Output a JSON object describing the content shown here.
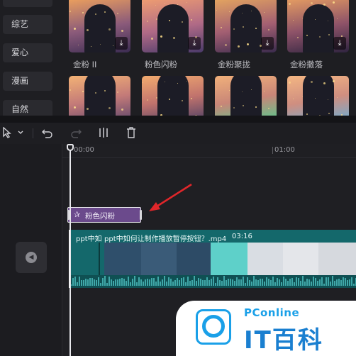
{
  "categories": [
    {
      "label": ""
    },
    {
      "label": "综艺"
    },
    {
      "label": "爱心"
    },
    {
      "label": "漫画"
    },
    {
      "label": "自然"
    }
  ],
  "effects_row1": [
    {
      "label": "金粉 II",
      "palette": [
        "#f0a35c",
        "#8a5a7a",
        "#3b2c52"
      ]
    },
    {
      "label": "粉色闪粉",
      "palette": [
        "#f2a070",
        "#b06a86",
        "#4a3a6a"
      ]
    },
    {
      "label": "金粉聚拢",
      "palette": [
        "#e7a85f",
        "#a35f72",
        "#3a2b4d"
      ]
    },
    {
      "label": "金粉撒落",
      "palette": [
        "#e9a062",
        "#8d5268",
        "#2f2440"
      ]
    }
  ],
  "effects_row2": [
    {
      "palette": [
        "#f3b275",
        "#c37a78",
        "#6b4d6e"
      ]
    },
    {
      "palette": [
        "#f2ab6f",
        "#c1736d",
        "#5d4766"
      ]
    },
    {
      "palette": [
        "#f1b07a",
        "#c88678",
        "#65c28c"
      ]
    },
    {
      "palette": [
        "#f4b683",
        "#cf8e80",
        "#7aa9c9"
      ]
    }
  ],
  "toolbar": {
    "select_icon": "pointer-icon",
    "undo_icon": "undo-icon",
    "redo_icon": "redo-icon",
    "split_icon": "split-icon",
    "delete_icon": "trash-icon"
  },
  "timeline": {
    "start_time": "00:00",
    "marker_time": "01:00",
    "effect_clip_label": "粉色闪粉",
    "video_clip_short": "ppt中如",
    "video_clip_title": "ppt中如何让制作播放暂停按钮？.mp4",
    "video_clip_duration": "03:16"
  },
  "watermark": {
    "brand": "PConline",
    "name": "IT百科"
  },
  "colors": {
    "effect_clip": "#6b4a8c",
    "video_track": "#14686b",
    "arrow": "#e0262a",
    "brand": "#1aa0e8"
  }
}
